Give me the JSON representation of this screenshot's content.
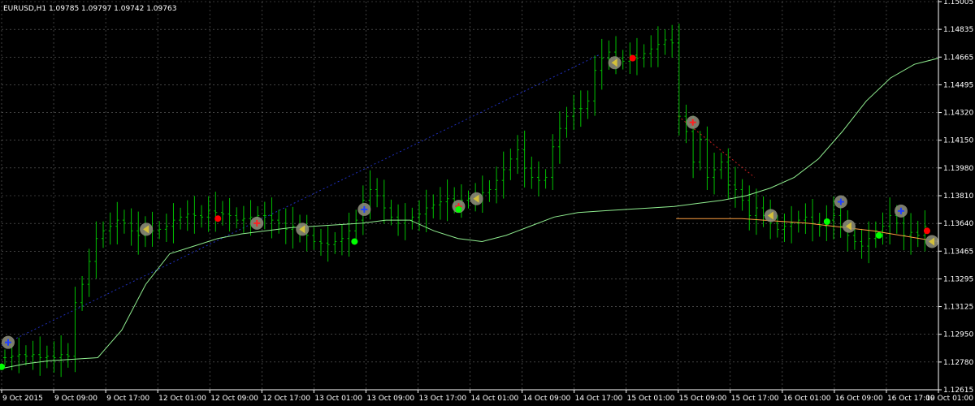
{
  "symbol_header": "EURUSD,H1  1.09785 1.09797 1.09742 1.09763",
  "colors": {
    "background": "#000000",
    "grid": "#c0c0c0",
    "axis": "#ffffff",
    "bar": "#00c000",
    "ma_line": "#90ee90",
    "trend_line": "#ffa040",
    "signal_up_dot": "#00ff00",
    "signal_down_dot": "#ff0000",
    "marker_fill": "#8a8a78",
    "marker_arrow": "#d4c03a",
    "marker_cross_blue": "#2040ff",
    "marker_cross_red": "#ff2020",
    "dotted_blue": "#2030c0",
    "dotted_red": "#d02020"
  },
  "chart_data": {
    "type": "ohlc-bars",
    "title": "EURUSD,H1",
    "ohlc_header": "1.09785 1.09797 1.09742 1.09763",
    "ylim": [
      1.1261,
      1.1515
    ],
    "y_ticks": [
      "1.15005",
      "1.14835",
      "1.14665",
      "1.14495",
      "1.14320",
      "1.14150",
      "1.13980",
      "1.13810",
      "1.13640",
      "1.13465",
      "1.13295",
      "1.13125",
      "1.12950",
      "1.12780",
      "1.12615"
    ],
    "x_ticks": [
      "9 Oct 2015",
      "9 Oct 09:00",
      "9 Oct 17:00",
      "12 Oct 01:00",
      "12 Oct 09:00",
      "12 Oct 17:00",
      "13 Oct 01:00",
      "13 Oct 09:00",
      "13 Oct 17:00",
      "14 Oct 01:00",
      "14 Oct 09:00",
      "14 Oct 17:00",
      "15 Oct 01:00",
      "15 Oct 09:00",
      "15 Oct 17:00",
      "16 Oct 01:00",
      "16 Oct 09:00",
      "16 Oct 17:00",
      "19 Oct 01:00"
    ],
    "grid": true,
    "bars_close": [
      1.1282,
      1.1283,
      1.1284,
      1.1283,
      1.1284,
      1.1282,
      1.1283,
      1.1282,
      1.1284,
      1.1283,
      1.1318,
      1.133,
      1.1345,
      1.136,
      1.1365,
      1.1368,
      1.1372,
      1.137,
      1.1365,
      1.1362,
      1.1367,
      1.1365,
      1.1366,
      1.1368,
      1.1372,
      1.1374,
      1.1376,
      1.1375,
      1.1374,
      1.1378,
      1.1377,
      1.1376,
      1.1375,
      1.1372,
      1.1373,
      1.1374,
      1.1375,
      1.1375,
      1.1372,
      1.137,
      1.1366,
      1.1368,
      1.1365,
      1.1362,
      1.1358,
      1.1357,
      1.1356,
      1.1358,
      1.136,
      1.1365,
      1.1372,
      1.1385,
      1.1392,
      1.1388,
      1.138,
      1.1374,
      1.137,
      1.1372,
      1.1374,
      1.1376,
      1.138,
      1.1382,
      1.1384,
      1.1386,
      1.1384,
      1.1385,
      1.1386,
      1.1388,
      1.139,
      1.1392,
      1.1398,
      1.1405,
      1.1412,
      1.1418,
      1.1406,
      1.14,
      1.1398,
      1.14,
      1.142,
      1.1432,
      1.144,
      1.1445,
      1.1445,
      1.145,
      1.147,
      1.1478,
      1.1482,
      1.1478,
      1.1476,
      1.148,
      1.1478,
      1.1481,
      1.1484,
      1.1487,
      1.149,
      1.1488,
      1.144,
      1.143,
      1.141,
      1.1425,
      1.14,
      1.1405,
      1.141,
      1.1395,
      1.1392,
      1.1385,
      1.1375,
      1.138,
      1.1375,
      1.137,
      1.1366,
      1.1368,
      1.137,
      1.1372,
      1.1374,
      1.137,
      1.1368,
      1.1372,
      1.1375,
      1.1368,
      1.1362,
      1.1358,
      1.1355,
      1.136,
      1.1365,
      1.1368,
      1.1375,
      1.137,
      1.1362,
      1.1364,
      1.1362,
      1.1368
    ],
    "ma_line": [
      1.1275,
      1.1278,
      1.128,
      1.1281,
      1.1282,
      1.13,
      1.133,
      1.135,
      1.1355,
      1.136,
      1.1363,
      1.1365,
      1.1367,
      1.1368,
      1.1369,
      1.137,
      1.1372,
      1.1372,
      1.1365,
      1.136,
      1.1358,
      1.1362,
      1.1368,
      1.1374,
      1.1377,
      1.1378,
      1.1379,
      1.138,
      1.1381,
      1.1383,
      1.1385,
      1.1388,
      1.1393,
      1.14,
      1.1412,
      1.143,
      1.145,
      1.1465,
      1.1474,
      1.1478
    ],
    "trend_line": [
      1.1373,
      1.1373,
      1.137,
      1.1365,
      1.1358
    ],
    "signal_points": [
      {
        "type": "up",
        "label": "9 Oct 2015",
        "price": 1.1276
      },
      {
        "type": "down",
        "label": "12 Oct 09:00",
        "price": 1.1373
      },
      {
        "type": "up",
        "label": "13 Oct 01:00",
        "price": 1.1358
      },
      {
        "type": "up",
        "label": "13 Oct 17:00",
        "price": 1.1379
      },
      {
        "type": "down",
        "label": "15 Oct 01:00",
        "price": 1.1478
      },
      {
        "type": "up",
        "label": "16 Oct 01:00",
        "price": 1.1371
      },
      {
        "type": "up",
        "label": "16 Oct 09:00",
        "price": 1.1362
      },
      {
        "type": "down",
        "label": "16 Oct 17:00",
        "price": 1.1365
      }
    ]
  }
}
